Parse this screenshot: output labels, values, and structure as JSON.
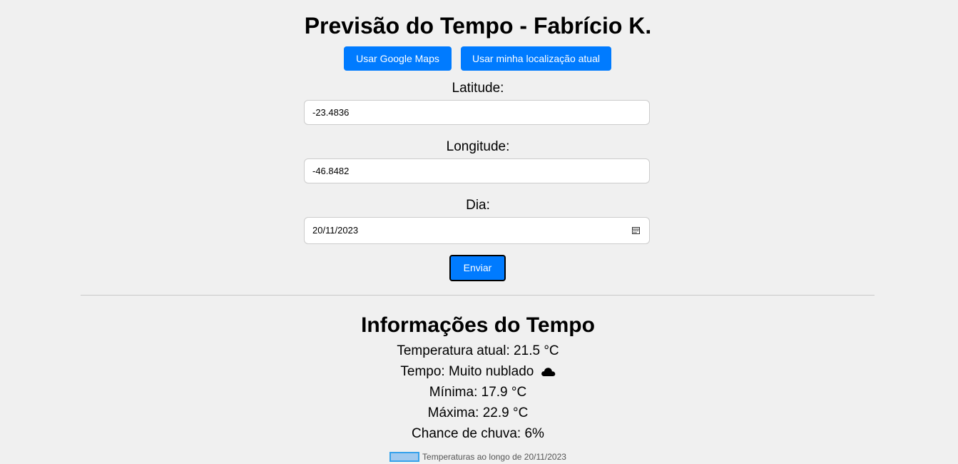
{
  "header": {
    "title": "Previsão do Tempo - Fabrício K."
  },
  "actions": {
    "google_maps_label": "Usar Google Maps",
    "current_location_label": "Usar minha localização atual",
    "submit_label": "Enviar"
  },
  "form": {
    "latitude": {
      "label": "Latitude:",
      "value": "-23.4836"
    },
    "longitude": {
      "label": "Longitude:",
      "value": "-46.8482"
    },
    "day": {
      "label": "Dia:",
      "value": "20/11/2023",
      "icon": "calendar-icon"
    }
  },
  "weather": {
    "heading": "Informações do Tempo",
    "current_temp": "Temperatura atual: 21.5 °C",
    "condition": "Tempo: Muito nublado",
    "condition_icon": "cloud-icon",
    "min_temp": "Mínima: 17.9 °C",
    "max_temp": "Máxima: 22.9 °C",
    "rain_chance": "Chance de chuva: 6%"
  },
  "chart": {
    "legend_label": "Temperaturas ao longo de 20/11/2023",
    "legend_color": "#36a2eb"
  },
  "colors": {
    "primary_button": "#007bff",
    "background": "#f0f0f0"
  }
}
